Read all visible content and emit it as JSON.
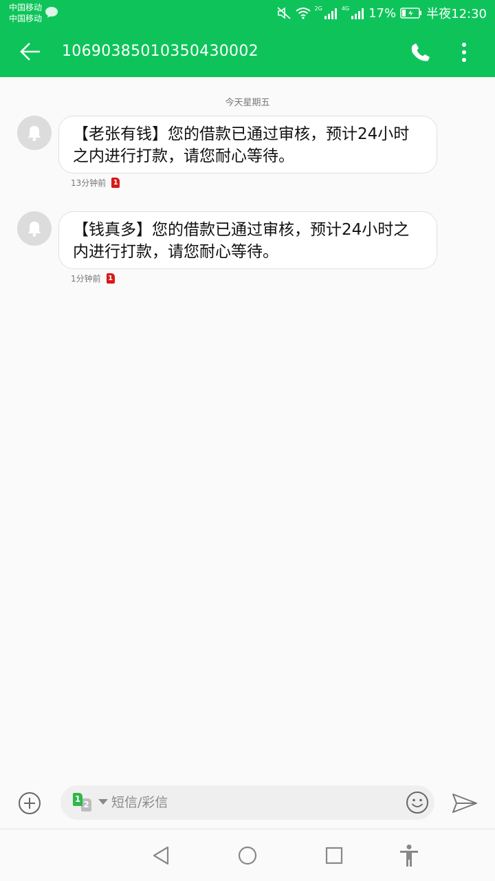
{
  "status_bar": {
    "carrier_1": "中国移动",
    "carrier_2": "中国移动",
    "net_tag_1": "2G",
    "net_tag_2": "4G",
    "battery": "17%",
    "time": "半夜12:30",
    "icons": [
      "wechat-icon",
      "mute-icon",
      "wifi-icon",
      "signal-icon",
      "battery-icon"
    ]
  },
  "app_bar": {
    "title": "10690385010350430002",
    "icons": [
      "back-arrow-icon",
      "phone-icon",
      "more-vert-icon"
    ],
    "accent": "#0ec45a"
  },
  "conversation": {
    "date_divider": "今天星期五",
    "messages": [
      {
        "text": "【老张有钱】您的借款已通过审核，预计24小时之内进行打款，请您耐心等待。",
        "time": "13分钟前",
        "sim": "1"
      },
      {
        "text": "【钱真多】您的借款已通过审核，预计24小时之内进行打款，请您耐心等待。",
        "time": "1分钟前",
        "sim": "1"
      }
    ]
  },
  "composer": {
    "sim_primary": "1",
    "sim_secondary": "2",
    "placeholder": "短信/彩信",
    "icons": [
      "add-circle-icon",
      "emoji-icon",
      "send-icon",
      "dropdown-caret-icon"
    ]
  },
  "nav_bar": {
    "icons": [
      "nav-back-icon",
      "nav-home-icon",
      "nav-recents-icon",
      "accessibility-icon"
    ]
  }
}
